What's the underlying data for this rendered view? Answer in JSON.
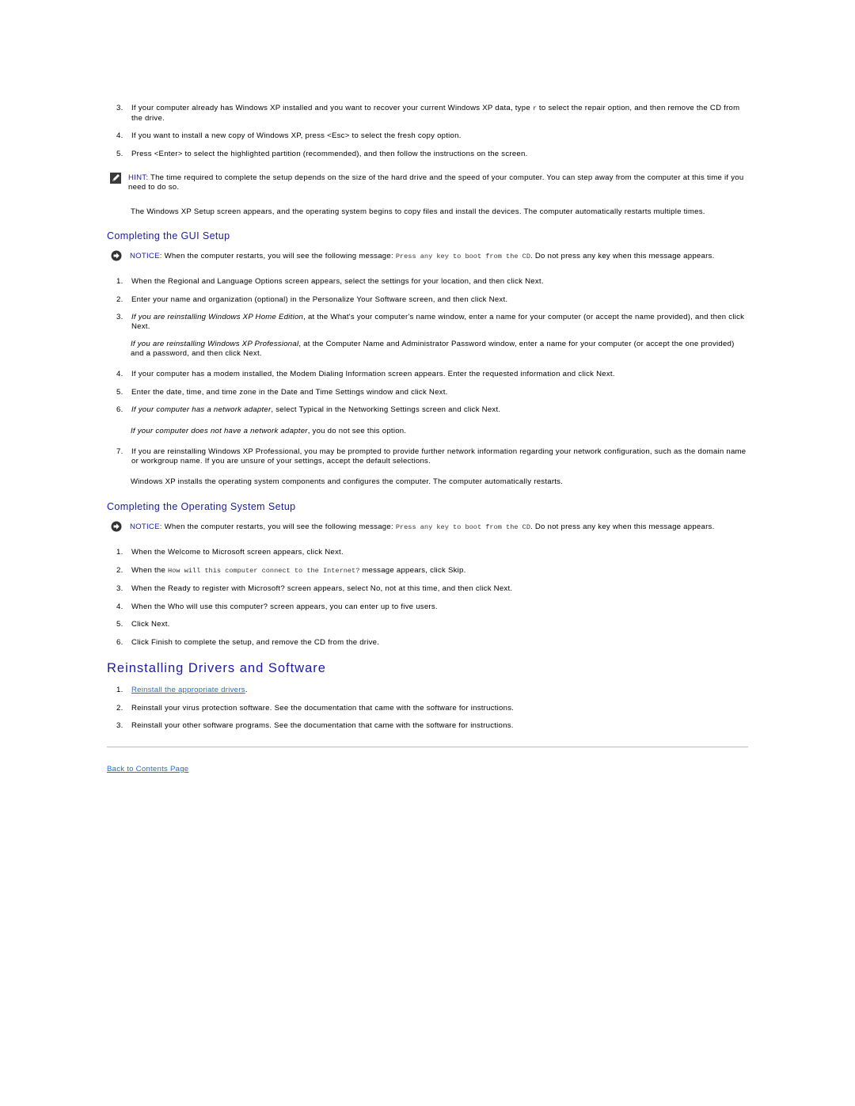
{
  "steps_top": [
    {
      "num": "3.",
      "text": "If your computer already has Windows XP installed and you want to recover your current Windows XP data, type ",
      "code": "r",
      "text_after": " to select the repair option, and then remove the CD from the drive."
    },
    {
      "num": "4.",
      "text": "If you want to install a new copy of Windows XP, press <Esc> to select the fresh copy option."
    },
    {
      "num": "5.",
      "text": "Press <Enter> to select the highlighted partition (recommended), and then follow the instructions on the screen."
    }
  ],
  "hint": {
    "icon": "pencil-note-icon",
    "label": "HINT:",
    "text": " The time required to complete the setup depends on the size of the hard drive and the speed of your computer. You can step away from the computer at this time if you need to do so."
  },
  "setup_paragraph": "The Windows XP Setup screen appears, and the operating system begins to copy files and install the devices. The computer automatically restarts multiple times.",
  "gui_setup": {
    "heading": "Completing the GUI Setup",
    "notice": {
      "icon": "notice-arrow-icon",
      "label": "NOTICE:",
      "text": " When the computer restarts, you will see the following message: ",
      "code": "Press any key to boot from the CD",
      "text_after": ". Do not press any key when this message appears."
    },
    "steps": [
      {
        "num": "1.",
        "text": "When the Regional and Language Options screen appears, select the settings for your location, and then click Next."
      },
      {
        "num": "2.",
        "text": "Enter your name and organization (optional) in the Personalize Your Software screen, and then click Next."
      },
      {
        "num": "3.",
        "italic": "If you are reinstalling Windows XP Home Edition",
        "text": ", at the What's your computer's name window, enter a name for your computer (or accept the name provided), and then click Next."
      }
    ],
    "step3_sub": {
      "italic": "If you are reinstalling Windows XP Professional",
      "text": ", at the Computer Name and Administrator Password window, enter a name for your computer (or accept the one provided) and a password, and then click Next."
    },
    "steps2": [
      {
        "num": "4.",
        "text": "If your computer has a modem installed, the Modem Dialing Information screen appears. Enter the requested information and click Next."
      },
      {
        "num": "5.",
        "text": "Enter the date, time, and time zone in the Date and Time Settings window and click Next."
      },
      {
        "num": "6.",
        "italic": "If your computer has a network adapter",
        "text": ", select Typical in the Networking Settings screen and click Next."
      }
    ],
    "step6_sub": {
      "italic": "If your computer does not have a network adapter",
      "text": ", you do not see this option."
    },
    "step7": {
      "num": "7.",
      "text": "If you are reinstalling Windows XP Professional, you may be prompted to provide further network information regarding your network configuration, such as the domain name or workgroup name. If you are unsure of your settings, accept the default selections."
    },
    "closing": "Windows XP installs the operating system components and configures the computer. The computer automatically restarts."
  },
  "os_setup": {
    "heading": "Completing the Operating System Setup",
    "notice": {
      "icon": "notice-arrow-icon",
      "label": "NOTICE:",
      "text": " When the computer restarts, you will see the following message: ",
      "code": "Press any key to boot from the CD",
      "text_after": ". Do not press any key when this message appears."
    },
    "steps": [
      {
        "num": "1.",
        "text": "When the Welcome to Microsoft screen appears, click Next."
      },
      {
        "num": "2.",
        "text": "When the ",
        "code": "How will this computer connect to the Internet?",
        "text_after": " message appears, click Skip."
      },
      {
        "num": "3.",
        "text": "When the Ready to register with Microsoft? screen appears, select No, not at this time, and then click Next."
      },
      {
        "num": "4.",
        "text": "When the Who will use this computer? screen appears, you can enter up to five users."
      },
      {
        "num": "5.",
        "text": "Click Next."
      },
      {
        "num": "6.",
        "text": "Click Finish to complete the setup, and remove the CD from the drive."
      }
    ]
  },
  "drivers": {
    "heading": "Reinstalling Drivers and Software",
    "steps": [
      {
        "num": "1.",
        "link": "Reinstall the appropriate drivers",
        "text": "."
      },
      {
        "num": "2.",
        "text": "Reinstall your virus protection software. See the documentation that came with the software for instructions."
      },
      {
        "num": "3.",
        "text": "Reinstall your other software programs. See the documentation that came with the software for instructions."
      }
    ]
  },
  "footer": {
    "back_link": "Back to Contents Page"
  },
  "colors": {
    "heading": "#1a1aa6",
    "link": "#1f6ed8",
    "rule": "#bbbbbb"
  }
}
